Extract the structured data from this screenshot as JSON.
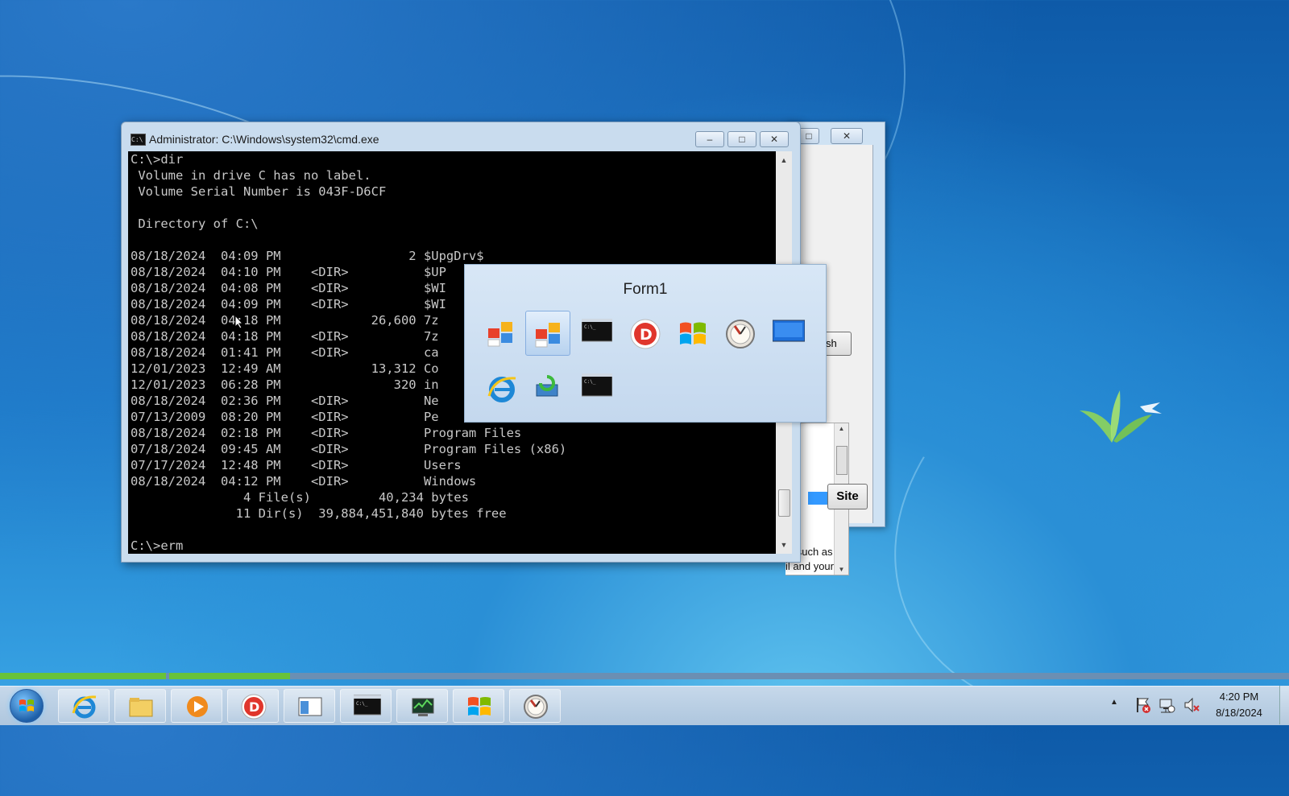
{
  "background_window": {
    "refresh_label": "Refresh",
    "site_label": "Site",
    "snippet_line1": "s, such as",
    "snippet_line2": "il and your"
  },
  "cmd_window": {
    "title": "Administrator: C:\\Windows\\system32\\cmd.exe",
    "minimize": "–",
    "maximize": "□",
    "close": "✕",
    "console_text": "C:\\>dir\n Volume in drive C has no label.\n Volume Serial Number is 043F-D6CF\n\n Directory of C:\\\n\n08/18/2024  04:09 PM                 2 $UpgDrv$\n08/18/2024  04:10 PM    <DIR>          $UP\n08/18/2024  04:08 PM    <DIR>          $WI\n08/18/2024  04:09 PM    <DIR>          $WI\n08/18/2024  04:18 PM            26,600 7z\n08/18/2024  04:18 PM    <DIR>          7z\n08/18/2024  01:41 PM    <DIR>          ca\n12/01/2023  12:49 AM            13,312 Co\n12/01/2023  06:28 PM               320 in\n08/18/2024  02:36 PM    <DIR>          Ne\n07/13/2009  08:20 PM    <DIR>          Pe\n08/18/2024  02:18 PM    <DIR>          Program Files\n07/18/2024  09:45 AM    <DIR>          Program Files (x86)\n07/17/2024  12:48 PM    <DIR>          Users\n08/18/2024  04:12 PM    <DIR>          Windows\n               4 File(s)         40,234 bytes\n              11 Dir(s)  39,884,451,840 bytes free\n\nC:\\>erm"
  },
  "popup": {
    "title": "Form1",
    "icons": [
      "windows-flag-squares-icon",
      "windows-flag-squares-icon",
      "command-prompt-icon",
      "dolby-d-icon",
      "windows-logo-icon",
      "clock-gauge-icon",
      "blue-screen-icon",
      "internet-explorer-icon",
      "network-refresh-icon",
      "command-prompt-icon"
    ],
    "selected_index": 1
  },
  "taskbar": {
    "progress": [
      0.13,
      0.22
    ],
    "items": [
      "internet-explorer-icon",
      "file-explorer-icon",
      "media-player-icon",
      "dolby-d-icon",
      "window-panel-icon",
      "command-prompt-icon",
      "task-manager-icon",
      "windows-logo-icon",
      "clock-gauge-icon"
    ],
    "tray_icons": [
      "show-hidden-icons-icon",
      "action-center-flag-icon",
      "network-icon",
      "volume-muted-icon"
    ],
    "time": "4:20 PM",
    "date": "8/18/2024"
  },
  "colors": {
    "console_bg": "#000000",
    "console_fg": "#c8c8c8",
    "progress_green": "#68c23a",
    "selection_blue": "#3399ff"
  }
}
